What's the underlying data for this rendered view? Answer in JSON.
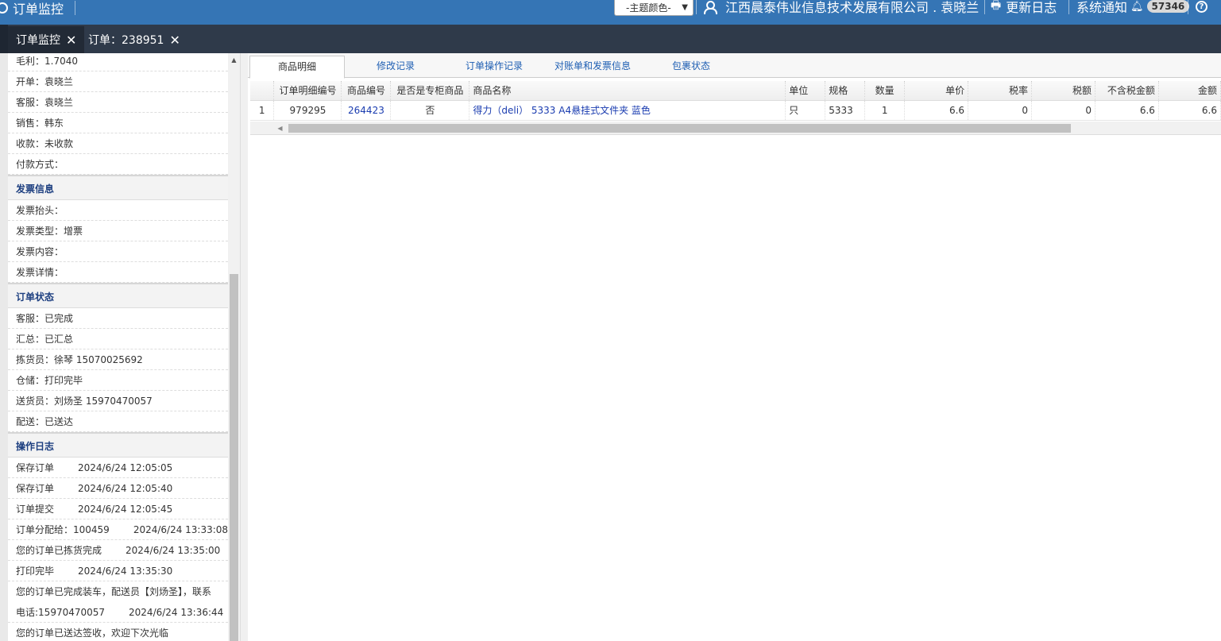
{
  "topbar": {
    "title": "订单监控",
    "theme_select": "-主题颜色-",
    "user": "江西晨泰伟业信息技术发展有限公司 . 袁晓兰",
    "changelog": "更新日志",
    "notifications": "系统通知",
    "notification_count": "57346"
  },
  "tabs": [
    {
      "label": "订单监控",
      "close": "✕"
    },
    {
      "label": "订单：238951",
      "close": "✕"
    }
  ],
  "left": {
    "order_rows": [
      {
        "label": "毛利：",
        "value": "1.7040"
      },
      {
        "label": "开单：",
        "value": "袁晓兰"
      },
      {
        "label": "客服：",
        "value": "袁晓兰"
      },
      {
        "label": "销售：",
        "value": "韩东"
      },
      {
        "label": "收款：",
        "value": "未收款"
      },
      {
        "label": "付款方式：",
        "value": ""
      }
    ],
    "invoice_title": "发票信息",
    "invoice_rows": [
      {
        "label": "发票抬头：",
        "value": ""
      },
      {
        "label": "发票类型：",
        "value": "增票"
      },
      {
        "label": "发票内容：",
        "value": ""
      },
      {
        "label": "发票详情：",
        "value": ""
      }
    ],
    "status_title": "订单状态",
    "status_rows": [
      {
        "label": "客服：",
        "value": "已完成"
      },
      {
        "label": "汇总：",
        "value": "已汇总"
      },
      {
        "label": "拣货员：",
        "value": "徐琴 15070025692"
      },
      {
        "label": "仓储：",
        "value": "打印完毕"
      },
      {
        "label": "送货员：",
        "value": "刘炀圣 15970470057"
      },
      {
        "label": "配送：",
        "value": "已送达"
      }
    ],
    "log_title": "操作日志",
    "log_rows": [
      {
        "text": "保存订单",
        "time": "2024/6/24 12:05:05"
      },
      {
        "text": "保存订单",
        "time": "2024/6/24 12:05:40"
      },
      {
        "text": "订单提交",
        "time": "2024/6/24 12:05:45"
      },
      {
        "text": "订单分配给：100459",
        "time": "2024/6/24 13:33:08"
      },
      {
        "text": "您的订单已拣货完成",
        "time": "2024/6/24 13:35:00"
      },
      {
        "text": "打印完毕",
        "time": "2024/6/24 13:35:30"
      },
      {
        "text": "您的订单已完成装车，配送员【刘炀圣】，联系",
        "time": ""
      },
      {
        "text": "电话:15970470057",
        "time": "2024/6/24 13:36:44"
      },
      {
        "text": "您的订单已送达签收，欢迎下次光临",
        "time": ""
      }
    ]
  },
  "subtabs": [
    "商品明细",
    "修改记录",
    "订单操作记录",
    "对账单和发票信息",
    "包裹状态"
  ],
  "grid": {
    "columns": [
      "",
      "订单明细编号",
      "商品编号",
      "是否是专柜商品",
      "商品名称",
      "单位",
      "规格",
      "数量",
      "单价",
      "税率",
      "税额",
      "不含税金额",
      "金额"
    ],
    "rows": [
      [
        "1",
        "979295",
        "264423",
        "否",
        "得力（deli） 5333 A4悬挂式文件夹 蓝色",
        "只",
        "5333",
        "1",
        "6.6",
        "0",
        "0",
        "6.6",
        "6.6"
      ]
    ]
  }
}
